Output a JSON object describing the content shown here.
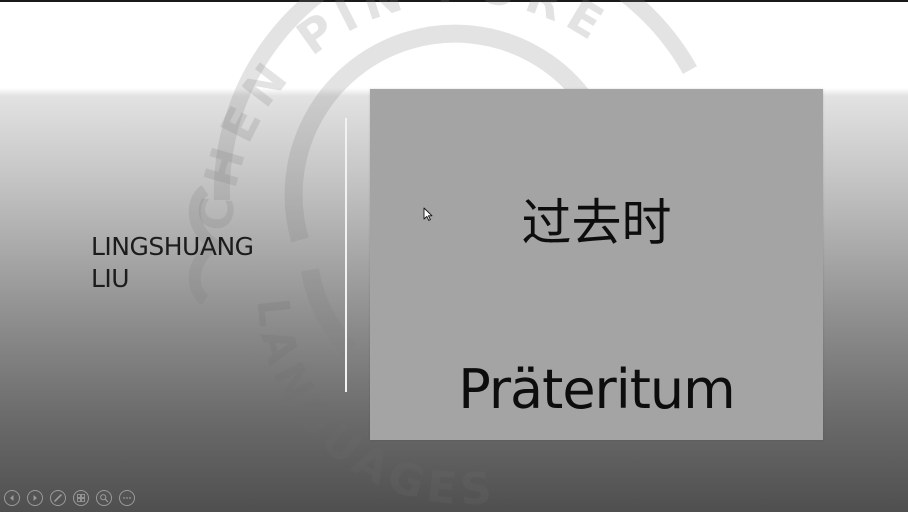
{
  "slide": {
    "presenter_name_line1": "LINGSHUANG",
    "presenter_name_line2": "LIU",
    "chinese_title": "过去时",
    "german_term": "Präteritum",
    "watermark_text_top": "CHEN PIN FORE",
    "watermark_text_bottom": "LANGUAGES"
  },
  "controls": [
    {
      "name": "previous-slide",
      "icon": "arrow-left-icon"
    },
    {
      "name": "next-slide",
      "icon": "arrow-right-icon"
    },
    {
      "name": "pen-tool",
      "icon": "pen-icon"
    },
    {
      "name": "slide-overview",
      "icon": "grid-icon"
    },
    {
      "name": "zoom",
      "icon": "magnifier-icon"
    },
    {
      "name": "more-options",
      "icon": "ellipsis-icon"
    }
  ],
  "colors": {
    "content_box": "#a4a4a4",
    "text": "#0d0d0d",
    "divider": "#f2f2f2"
  }
}
